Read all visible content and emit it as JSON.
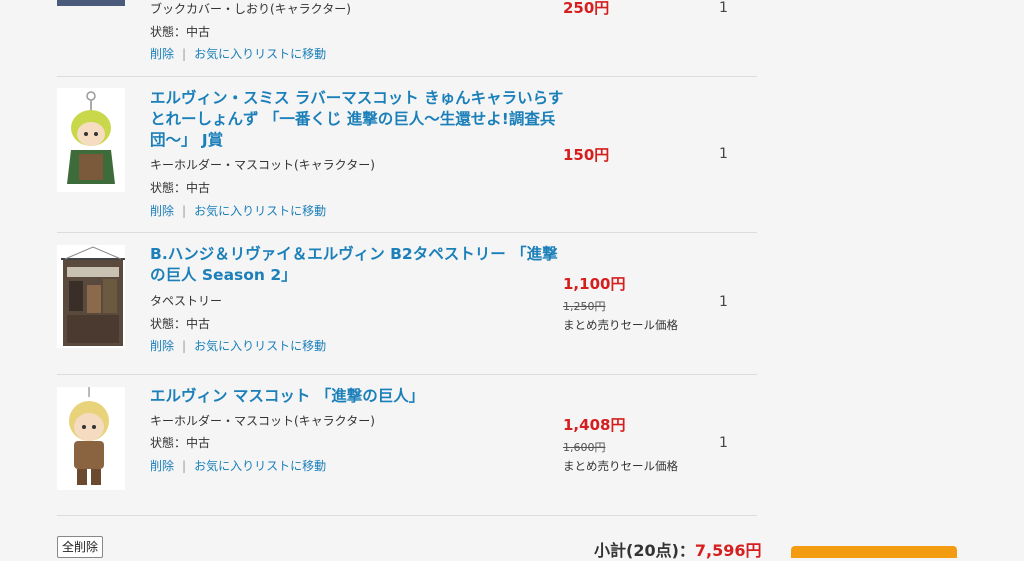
{
  "items": [
    {
      "title": "",
      "category": "ブックカバー・しおり(キャラクター)",
      "condition": "状態：中古",
      "delete_label": "削除",
      "separator": "|",
      "move_label": "お気に入りリストに移動",
      "price": "250円",
      "quantity": "1"
    },
    {
      "title": "エルヴィン・スミス ラバーマスコット きゅんキャラいらすとれーしょんず 「一番くじ 進撃の巨人～生還せよ!調査兵団～」 J賞",
      "category": "キーホルダー・マスコット(キャラクター)",
      "condition": "状態：中古",
      "delete_label": "削除",
      "separator": "|",
      "move_label": "お気に入りリストに移動",
      "price": "150円",
      "quantity": "1"
    },
    {
      "title": "B.ハンジ＆リヴァイ＆エルヴィン B2タペストリー 「進撃の巨人 Season 2」",
      "category": "タペストリー",
      "condition": "状態：中古",
      "delete_label": "削除",
      "separator": "|",
      "move_label": "お気に入りリストに移動",
      "price": "1,100円",
      "original_price": "1,250円",
      "price_note": "まとめ売りセール価格",
      "quantity": "1"
    },
    {
      "title": "エルヴィン マスコット 「進撃の巨人」",
      "category": "キーホルダー・マスコット(キャラクター)",
      "condition": "状態：中古",
      "delete_label": "削除",
      "separator": "|",
      "move_label": "お気に入りリストに移動",
      "price": "1,408円",
      "original_price": "1,600円",
      "price_note": "まとめ売りセール価格",
      "quantity": "1"
    }
  ],
  "footer": {
    "delete_all_label": "全削除",
    "subtotal_label": "小計(20点)：",
    "subtotal_amount": "7,596円"
  },
  "colors": {
    "link": "#1b7fb9",
    "price": "#d51f1f",
    "checkout_button": "#f39c12"
  }
}
